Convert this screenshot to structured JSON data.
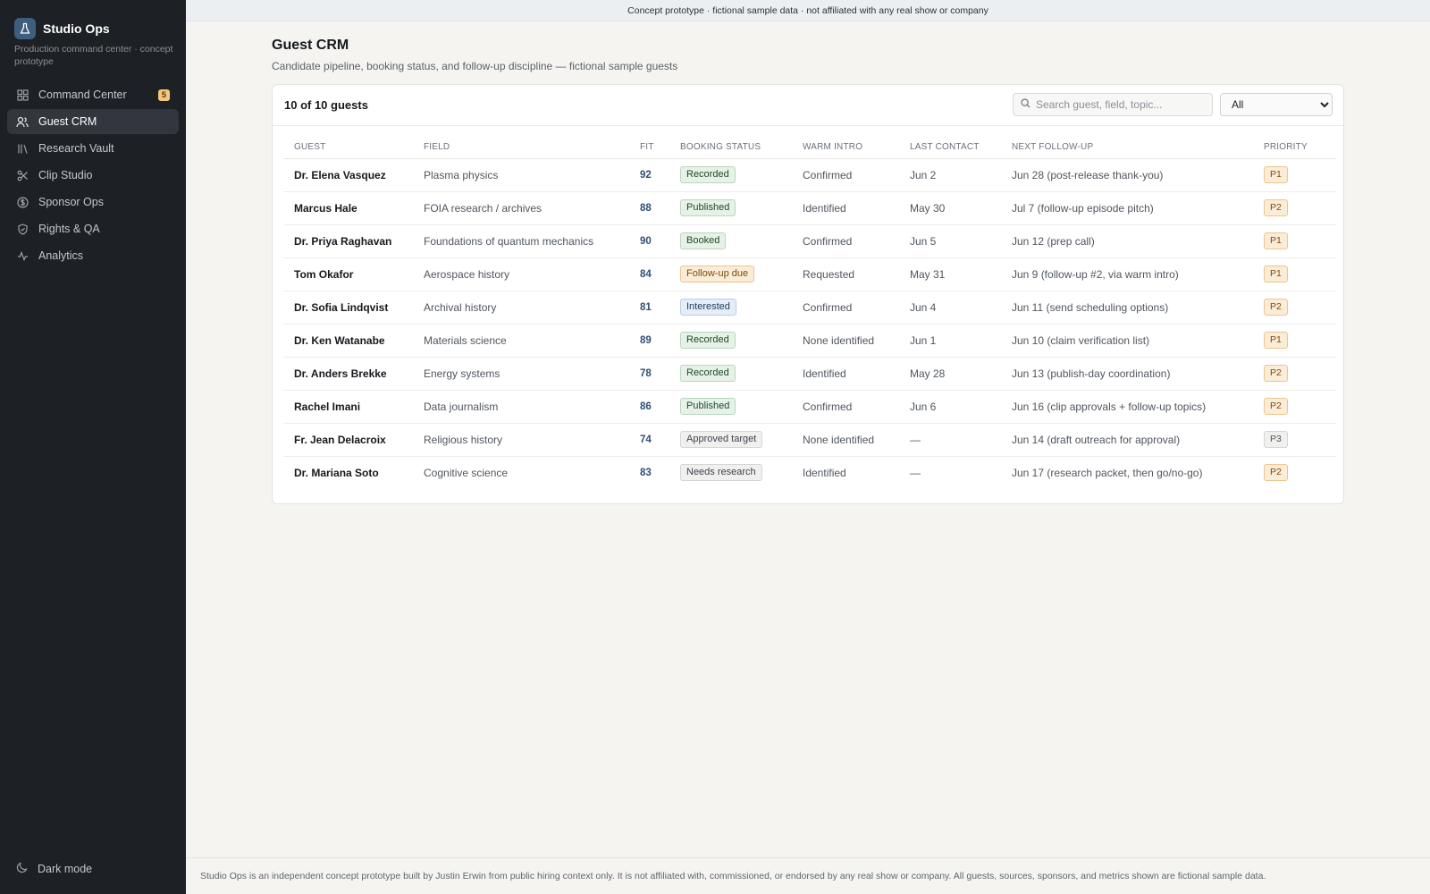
{
  "app": {
    "name": "Studio Ops",
    "subtitle": "Production command center · concept prototype"
  },
  "nav": [
    {
      "label": "Command Center",
      "icon": "grid-icon",
      "badge": "5",
      "active": false
    },
    {
      "label": "Guest CRM",
      "icon": "users-icon",
      "active": true
    },
    {
      "label": "Research Vault",
      "icon": "library-icon",
      "active": false
    },
    {
      "label": "Clip Studio",
      "icon": "scissors-icon",
      "active": false
    },
    {
      "label": "Sponsor Ops",
      "icon": "dollar-circle-icon",
      "active": false
    },
    {
      "label": "Rights & QA",
      "icon": "shield-check-icon",
      "active": false
    },
    {
      "label": "Analytics",
      "icon": "activity-icon",
      "active": false
    }
  ],
  "dark_mode_label": "Dark mode",
  "banner": "Concept prototype · fictional sample data · not affiliated with any real show or company",
  "page": {
    "title": "Guest CRM",
    "subtitle": "Candidate pipeline, booking status, and follow-up discipline — fictional sample guests"
  },
  "toolbar": {
    "count": "10 of 10 guests",
    "search_placeholder": "Search guest, field, topic...",
    "filter_value": "All"
  },
  "columns": [
    "GUEST",
    "FIELD",
    "FIT",
    "BOOKING STATUS",
    "WARM INTRO",
    "LAST CONTACT",
    "NEXT FOLLOW-UP",
    "PRIORITY"
  ],
  "rows": [
    {
      "guest": "Dr. Elena Vasquez",
      "field": "Plasma physics",
      "fit": "92",
      "status": "Recorded",
      "status_tone": "green",
      "intro": "Confirmed",
      "last": "Jun 2",
      "next": "Jun 28 (post-release thank-you)",
      "priority": "P1"
    },
    {
      "guest": "Marcus Hale",
      "field": "FOIA research / archives",
      "fit": "88",
      "status": "Published",
      "status_tone": "green",
      "intro": "Identified",
      "last": "May 30",
      "next": "Jul 7 (follow-up episode pitch)",
      "priority": "P2"
    },
    {
      "guest": "Dr. Priya Raghavan",
      "field": "Foundations of quantum mechanics",
      "fit": "90",
      "status": "Booked",
      "status_tone": "green",
      "intro": "Confirmed",
      "last": "Jun 5",
      "next": "Jun 12 (prep call)",
      "priority": "P1"
    },
    {
      "guest": "Tom Okafor",
      "field": "Aerospace history",
      "fit": "84",
      "status": "Follow-up due",
      "status_tone": "orange",
      "intro": "Requested",
      "last": "May 31",
      "next": "Jun 9 (follow-up #2, via warm intro)",
      "priority": "P1"
    },
    {
      "guest": "Dr. Sofia Lindqvist",
      "field": "Archival history",
      "fit": "81",
      "status": "Interested",
      "status_tone": "blue",
      "intro": "Confirmed",
      "last": "Jun 4",
      "next": "Jun 11 (send scheduling options)",
      "priority": "P2"
    },
    {
      "guest": "Dr. Ken Watanabe",
      "field": "Materials science",
      "fit": "89",
      "status": "Recorded",
      "status_tone": "green",
      "intro": "None identified",
      "last": "Jun 1",
      "next": "Jun 10 (claim verification list)",
      "priority": "P1"
    },
    {
      "guest": "Dr. Anders Brekke",
      "field": "Energy systems",
      "fit": "78",
      "status": "Recorded",
      "status_tone": "green",
      "intro": "Identified",
      "last": "May 28",
      "next": "Jun 13 (publish-day coordination)",
      "priority": "P2"
    },
    {
      "guest": "Rachel Imani",
      "field": "Data journalism",
      "fit": "86",
      "status": "Published",
      "status_tone": "green",
      "intro": "Confirmed",
      "last": "Jun 6",
      "next": "Jun 16 (clip approvals + follow-up topics)",
      "priority": "P2"
    },
    {
      "guest": "Fr. Jean Delacroix",
      "field": "Religious history",
      "fit": "74",
      "status": "Approved target",
      "status_tone": "gray",
      "intro": "None identified",
      "last": "—",
      "next": "Jun 14 (draft outreach for approval)",
      "priority": "P3"
    },
    {
      "guest": "Dr. Mariana Soto",
      "field": "Cognitive science",
      "fit": "83",
      "status": "Needs research",
      "status_tone": "gray",
      "intro": "Identified",
      "last": "—",
      "next": "Jun 17 (research packet, then go/no-go)",
      "priority": "P2"
    }
  ],
  "footer": "Studio Ops is an independent concept prototype built by Justin Erwin from public hiring context only. It is not affiliated with, commissioned, or endorsed by any real show or company. All guests, sources, sponsors, and metrics shown are fictional sample data."
}
